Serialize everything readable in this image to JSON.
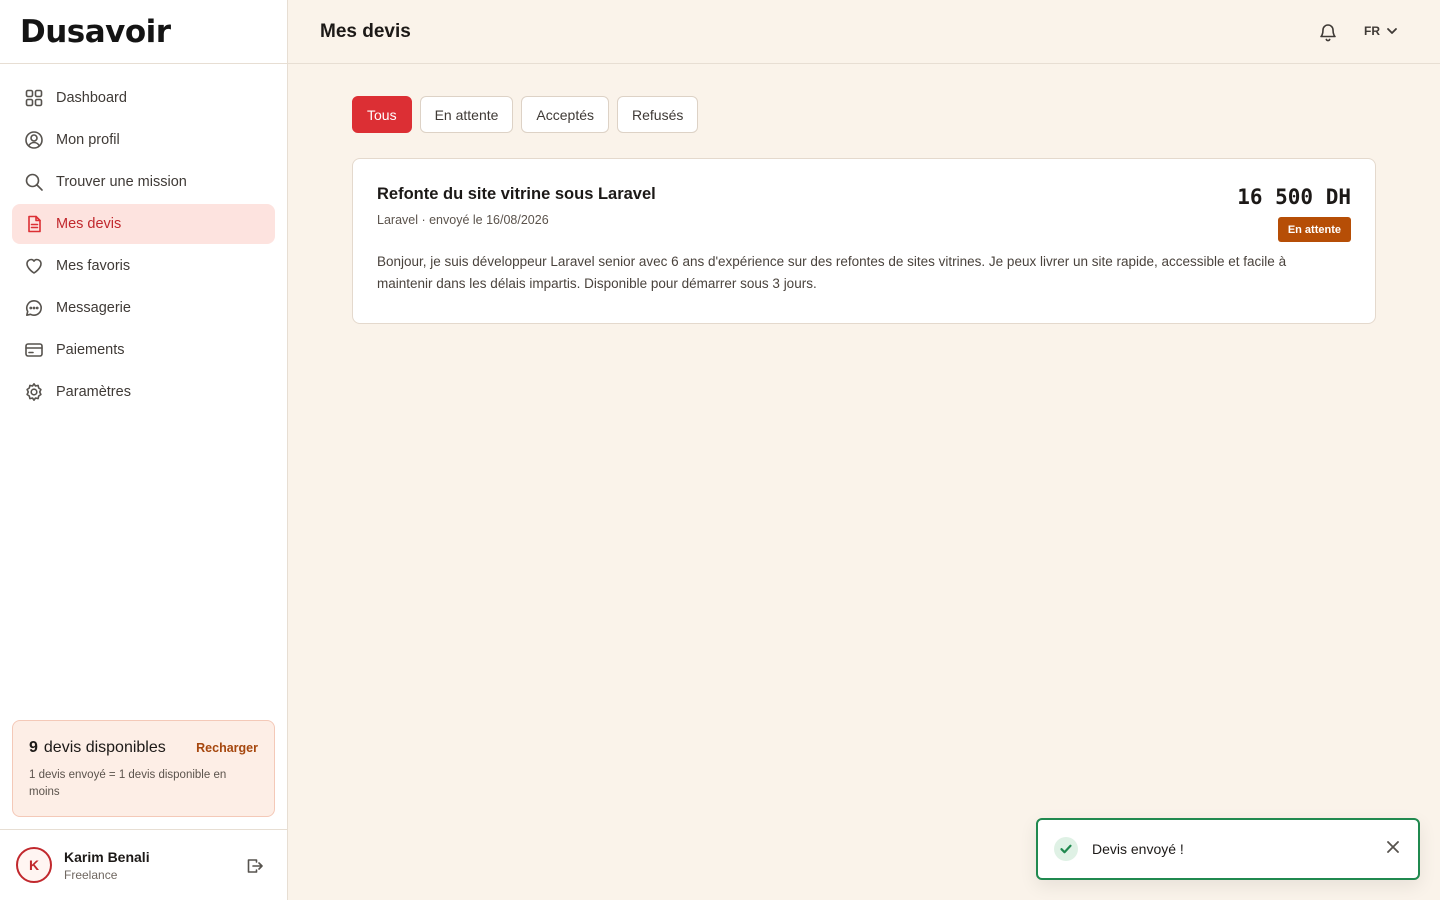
{
  "app": {
    "logo": "Dusavoir"
  },
  "sidebar": {
    "items": [
      {
        "label": "Dashboard",
        "icon": "grid-icon"
      },
      {
        "label": "Mon profil",
        "icon": "user-circle-icon"
      },
      {
        "label": "Trouver une mission",
        "icon": "search-icon"
      },
      {
        "label": "Mes devis",
        "icon": "document-icon",
        "active": true
      },
      {
        "label": "Mes favoris",
        "icon": "heart-icon"
      },
      {
        "label": "Messagerie",
        "icon": "chat-icon"
      },
      {
        "label": "Paiements",
        "icon": "credit-card-icon"
      },
      {
        "label": "Paramètres",
        "icon": "gear-icon"
      }
    ],
    "credits": {
      "count": "9",
      "label": "devis disponibles",
      "recharge": "Recharger",
      "note": "1 devis envoyé = 1 devis disponible en moins"
    },
    "user": {
      "initial": "K",
      "name": "Karim Benali",
      "role": "Freelance"
    }
  },
  "header": {
    "title": "Mes devis",
    "language": "FR"
  },
  "filters": {
    "tabs": [
      {
        "label": "Tous",
        "active": true
      },
      {
        "label": "En attente",
        "active": false
      },
      {
        "label": "Acceptés",
        "active": false
      },
      {
        "label": "Refusés",
        "active": false
      }
    ]
  },
  "quotes": [
    {
      "title": "Refonte du site vitrine sous Laravel",
      "meta": "Laravel · envoyé le 16/08/2026",
      "amount": "16 500 DH",
      "status": "En attente",
      "description": "Bonjour, je suis développeur Laravel senior avec 6 ans d'expérience sur des refontes de sites vitrines. Je peux livrer un site rapide, accessible et facile à maintenir dans les délais impartis. Disponible pour démarrer sous 3 jours."
    }
  ],
  "toast": {
    "message": "Devis envoyé !"
  },
  "colors": {
    "accent": "#dc2f34",
    "active_bg": "#fde3df",
    "pending_badge": "#b64e06",
    "success": "#20894f",
    "background": "#faf3ea"
  }
}
